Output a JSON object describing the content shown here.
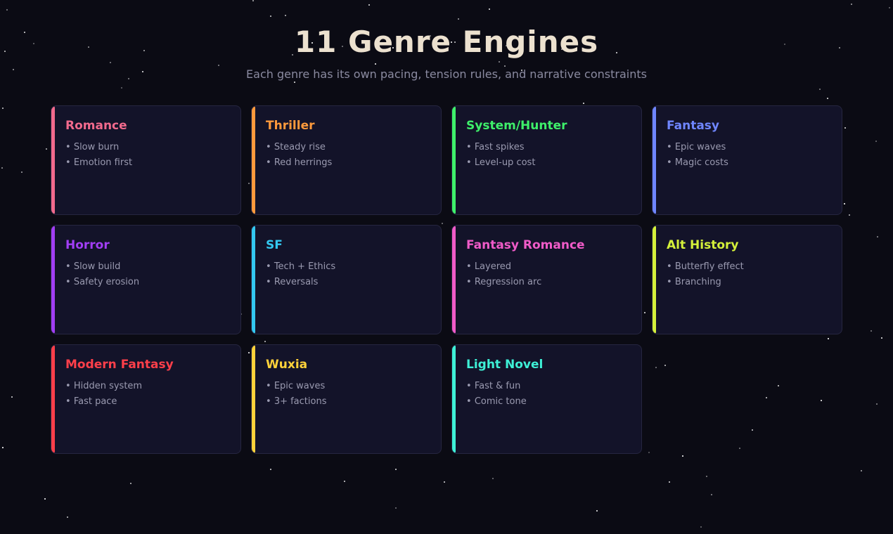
{
  "title": "11 Genre Engines",
  "subtitle": "Each genre has its own pacing, tension rules, and narrative constraints",
  "genres": [
    {
      "name": "Romance",
      "color": "#f26a8d",
      "traits": [
        "Slow burn",
        "Emotion first"
      ]
    },
    {
      "name": "Thriller",
      "color": "#ff9a3c",
      "traits": [
        "Steady rise",
        "Red herrings"
      ]
    },
    {
      "name": "System/Hunter",
      "color": "#3ef06a",
      "traits": [
        "Fast spikes",
        "Level-up cost"
      ]
    },
    {
      "name": "Fantasy",
      "color": "#6f86ff",
      "traits": [
        "Epic waves",
        "Magic costs"
      ]
    },
    {
      "name": "Horror",
      "color": "#a23ef5",
      "traits": [
        "Slow build",
        "Safety erosion"
      ]
    },
    {
      "name": "SF",
      "color": "#33c8f0",
      "traits": [
        "Tech + Ethics",
        "Reversals"
      ]
    },
    {
      "name": "Fantasy Romance",
      "color": "#f05bc8",
      "traits": [
        "Layered",
        "Regression arc"
      ]
    },
    {
      "name": "Alt History",
      "color": "#d4f03a",
      "traits": [
        "Butterfly effect",
        "Branching"
      ]
    },
    {
      "name": "Modern Fantasy",
      "color": "#ff3f4a",
      "traits": [
        "Hidden system",
        "Fast pace"
      ]
    },
    {
      "name": "Wuxia",
      "color": "#ffd23a",
      "traits": [
        "Epic waves",
        "3+ factions"
      ]
    },
    {
      "name": "Light Novel",
      "color": "#3ef0d6",
      "traits": [
        "Fast & fun",
        "Comic tone"
      ]
    }
  ],
  "colors": {
    "background": "#0b0b14",
    "card": "#131329",
    "title": "#ece1cf",
    "subtitle": "#8a8aa0",
    "trait_text": "#9a9ab0"
  }
}
